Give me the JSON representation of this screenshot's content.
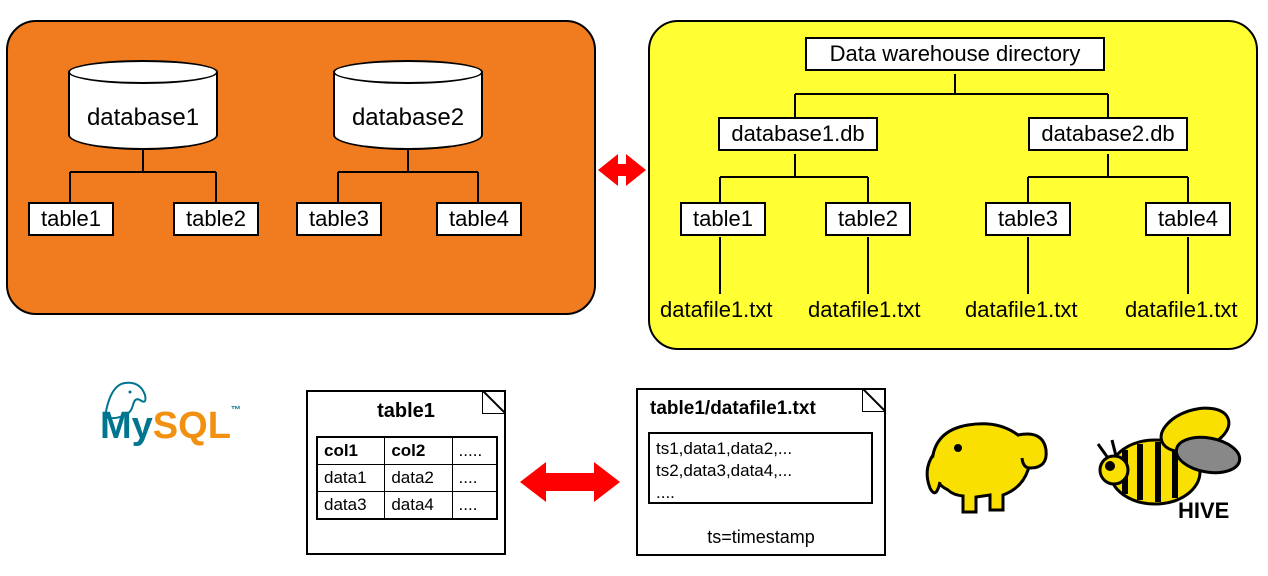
{
  "left_panel": {
    "db1": {
      "label": "database1",
      "t1": "table1",
      "t2": "table2"
    },
    "db2": {
      "label": "database2",
      "t3": "table3",
      "t4": "table4"
    }
  },
  "right_panel": {
    "root": "Data warehouse directory",
    "db1": "database1.db",
    "db2": "database2.db",
    "t1": "table1",
    "t2": "table2",
    "t3": "table3",
    "t4": "table4",
    "f1": "datafile1.txt",
    "f2": "datafile1.txt",
    "f3": "datafile1.txt",
    "f4": "datafile1.txt"
  },
  "bottom": {
    "mysql_table_title": "table1",
    "cols": {
      "c1": "col1",
      "c2": "col2",
      "c3": "....."
    },
    "rows": {
      "r1c1": "data1",
      "r1c2": "data2",
      "r1c3": "....",
      "r2c1": "data3",
      "r2c2": "data4",
      "r2c3": "...."
    },
    "hive_title": "table1/datafile1.txt",
    "hive_lines": "ts1,data1,data2,...\nts2,data3,data4,...\n....",
    "ts_note": "ts=timestamp",
    "mysql_label": "MySQL",
    "hive_label": "HIVE"
  }
}
